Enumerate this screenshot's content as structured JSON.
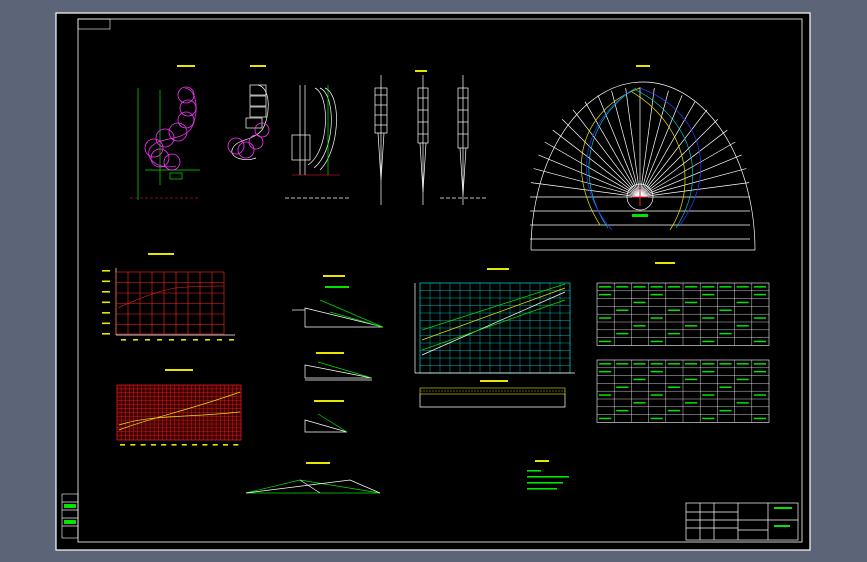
{
  "colors": {
    "background": "#5b6577",
    "sheet": "#000000",
    "frame": "#ffffff",
    "line_green": "#00e400",
    "line_white": "#ffffff",
    "line_yellow": "#e6e600",
    "line_cyan": "#00e0e0",
    "line_magenta": "#ff33ff",
    "line_red": "#ff2020",
    "line_blue": "#2a3cff"
  },
  "icons": {
    "north_mark": "crosshair-icon"
  }
}
